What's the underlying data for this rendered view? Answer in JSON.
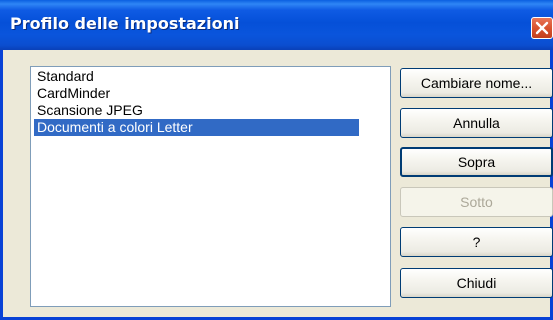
{
  "dialog": {
    "title": "Profilo delle impostazioni"
  },
  "profiles": {
    "items": [
      {
        "label": "Standard",
        "selected": false
      },
      {
        "label": "CardMinder",
        "selected": false
      },
      {
        "label": "Scansione JPEG",
        "selected": false
      },
      {
        "label": "Documenti a colori Letter",
        "selected": true
      }
    ]
  },
  "buttons": {
    "rename": "Cambiare nome...",
    "cancel": "Annulla",
    "up": "Sopra",
    "down": "Sotto",
    "help": "?",
    "close": "Chiudi"
  },
  "colors": {
    "titlebar": "#0550d8",
    "selection": "#316ac5",
    "dialog_background": "#ece9d8",
    "close_button": "#d9532f"
  },
  "icons": {
    "close": "close-icon"
  }
}
